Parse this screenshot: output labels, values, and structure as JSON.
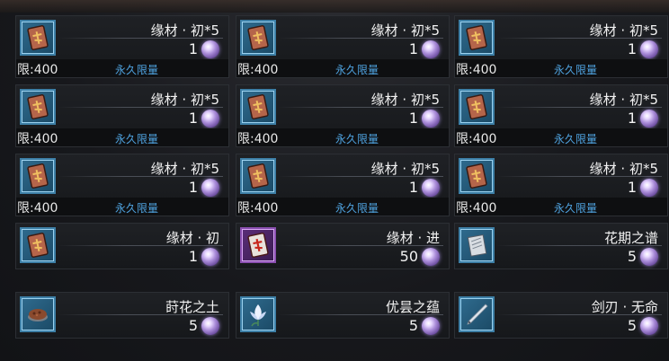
{
  "shop": {
    "currency_icon": "crystal-orb-icon",
    "items": [
      {
        "name": "缘材 · 初*5",
        "quantity": "1",
        "limit": "限:400",
        "limit_type": "永久限量",
        "icon": "rune-card-icon"
      },
      {
        "name": "缘材 · 初*5",
        "quantity": "1",
        "limit": "限:400",
        "limit_type": "永久限量",
        "icon": "rune-card-icon"
      },
      {
        "name": "缘材 · 初*5",
        "quantity": "1",
        "limit": "限:400",
        "limit_type": "永久限量",
        "icon": "rune-card-icon"
      },
      {
        "name": "缘材 · 初*5",
        "quantity": "1",
        "limit": "限:400",
        "limit_type": "永久限量",
        "icon": "rune-card-icon"
      },
      {
        "name": "缘材 · 初*5",
        "quantity": "1",
        "limit": "限:400",
        "limit_type": "永久限量",
        "icon": "rune-card-icon"
      },
      {
        "name": "缘材 · 初*5",
        "quantity": "1",
        "limit": "限:400",
        "limit_type": "永久限量",
        "icon": "rune-card-icon"
      },
      {
        "name": "缘材 · 初*5",
        "quantity": "1",
        "limit": "限:400",
        "limit_type": "永久限量",
        "icon": "rune-card-icon"
      },
      {
        "name": "缘材 · 初*5",
        "quantity": "1",
        "limit": "限:400",
        "limit_type": "永久限量",
        "icon": "rune-card-icon"
      },
      {
        "name": "缘材 · 初*5",
        "quantity": "1",
        "limit": "限:400",
        "limit_type": "永久限量",
        "icon": "rune-card-icon"
      },
      {
        "name": "缘材 · 初",
        "quantity": "1",
        "icon": "rune-card-icon"
      },
      {
        "name": "缘材 · 进",
        "quantity": "50",
        "icon": "red-rune-card-icon"
      },
      {
        "name": "花期之谱",
        "quantity": "5",
        "icon": "score-sheet-icon"
      },
      {
        "name": "莳花之土",
        "quantity": "5",
        "icon": "soil-bowl-icon"
      },
      {
        "name": "优昙之蕴",
        "quantity": "5",
        "icon": "lotus-flower-icon"
      },
      {
        "name": "剑刃 · 无命",
        "quantity": "5",
        "icon": "blade-icon"
      }
    ]
  }
}
